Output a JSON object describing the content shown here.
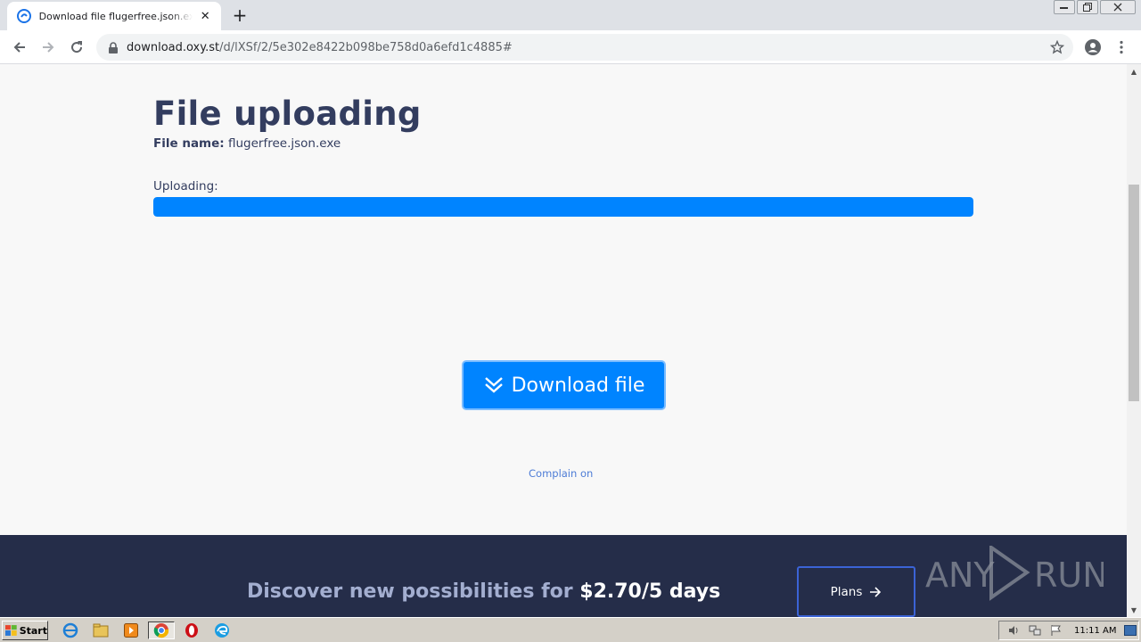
{
  "browser": {
    "tab_title": "Download file flugerfree.json.exe on",
    "tab_close": "✕",
    "new_tab": "+",
    "url_host": "download.oxy.st",
    "url_path": "/d/lXSf/2/5e302e8422b098be758d0a6efd1c4885#"
  },
  "page": {
    "title": "File uploading",
    "file_name_label": "File name:",
    "file_name_value": "flugerfree.json.exe",
    "uploading_label": "Uploading:",
    "upload_progress_percent": 100,
    "download_button_label": "Download file",
    "complain_link": "Complain on"
  },
  "banner": {
    "promo_text": "Discover new possibilities for ",
    "promo_price": "$2.70/5 days",
    "plans_button_label": "Plans"
  },
  "watermark": {
    "text_left": "ANY",
    "text_right": "RUN"
  },
  "taskbar": {
    "start_label": "Start",
    "clock": "11:11 AM"
  },
  "colors": {
    "accent_blue": "#0084ff",
    "title_navy": "#333d5f",
    "banner_bg": "#252d49"
  },
  "icons": [
    "back-arrow-icon",
    "forward-arrow-icon",
    "reload-icon",
    "lock-icon",
    "star-icon",
    "account-icon",
    "kebab-menu-icon",
    "double-chevron-down-icon",
    "arrow-right-icon"
  ]
}
